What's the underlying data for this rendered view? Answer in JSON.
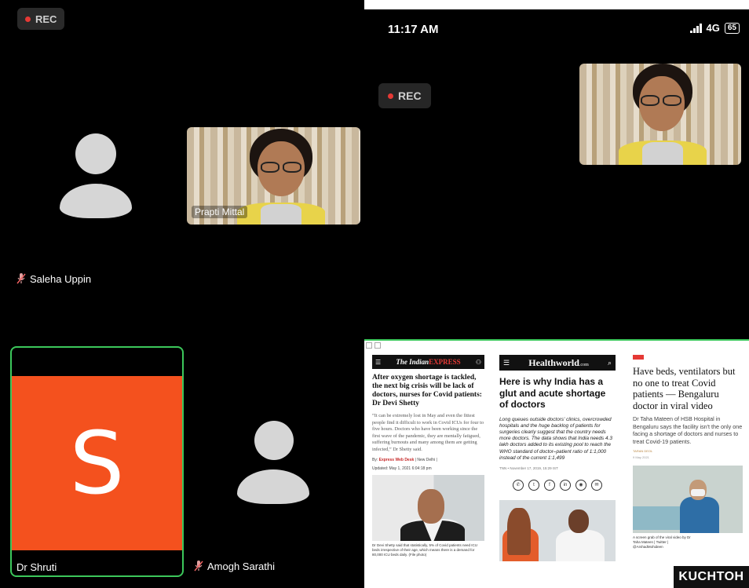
{
  "left_panel": {
    "rec_label": "REC",
    "participants": {
      "saleha": {
        "name": "Saleha Uppin",
        "muted": true
      },
      "prapti": {
        "name": "Prapti Mittal"
      },
      "shruti": {
        "name": "Dr Shruti",
        "initial": "S",
        "active_speaker": true
      },
      "amogh": {
        "name": "Amogh Sarathi",
        "muted": true
      }
    }
  },
  "right_panel": {
    "status_bar": {
      "time": "11:17 AM",
      "network": "4G",
      "battery": "65"
    },
    "rec_label": "REC",
    "news": {
      "article1": {
        "brand_prefix": "The Indian",
        "brand_suffix": "EXPRESS",
        "headline": "After oxygen shortage is tackled, the next big crisis will be lack of doctors, nurses for Covid patients: Dr Devi Shetty",
        "body": "“It can be extremely lost in May and even the fittest people find it difficult to work in Covid ICUs for four to five hours. Doctors who have been working since the first wave of the pandemic, they are mentally fatigued, suffering burnouts and many among them are getting infected,” Dr Shetty said.",
        "byline_by": "By:",
        "byline_author": "Express Web Desk",
        "byline_place": "| New Delhi |",
        "updated": "Updated: May 1, 2021 6:04:18 pm",
        "caption": "Dr Devi Shetty said that statistically, 5% of Covid patients need ICU beds irrespective of their age, which means there is a demand for 80,000 ICU beds daily. (File photo)"
      },
      "article2": {
        "brand": "Healthworld",
        "brand_suffix": ".com",
        "tagline": "From The Economic Times",
        "headline": "Here is why India has a glut and acute shortage of doctors",
        "summary": "Long queues outside doctors' clinics, overcrowded hospitals and the huge backlog of patients for surgeries clearly suggest that the country needs more doctors. The data shows that India needs 4.3 lakh doctors added to its existing pool to reach the WHO standard of doctor–patient ratio of 1:1,000 instead of the current 1:1,499",
        "meta": "TNN  •  November 17, 2019, 15:29 IST"
      },
      "article3": {
        "headline": "Have beds, ventilators but no one to treat Covid patients — Bengaluru doctor in viral video",
        "description": "Dr Taha Mateen of HSB Hospital in Bengaluru says the facility isn't the only one facing a shortage of doctors and nurses to treat Covid-19 patients.",
        "author": "TARAN DEOL",
        "date": "9 May 2021",
        "caption": "A screen grab of the viral video by Dr Taha Mateen | Twitter | @ArshadMohideen"
      },
      "watermark": "KUCHTOH"
    }
  },
  "colors": {
    "active_speaker_border": "#3cc75b",
    "avatar_orange": "#f4511e",
    "rec_dot": "#e53935"
  }
}
